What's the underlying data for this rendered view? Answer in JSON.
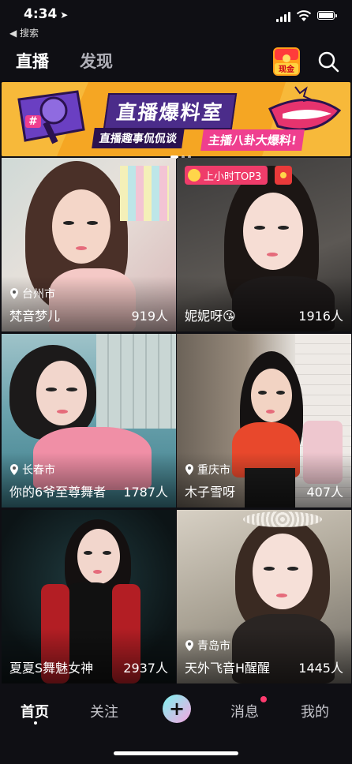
{
  "status_bar": {
    "time": "4:34",
    "back_label": "◀ 搜索"
  },
  "header": {
    "tabs": [
      {
        "label": "直播",
        "active": true
      },
      {
        "label": "发现",
        "active": false
      }
    ],
    "cash_label": "现金"
  },
  "banner": {
    "title": "直播爆料室",
    "subtitle_left": "直播趣事侃侃谈",
    "subtitle_right": "主播八卦大爆料!",
    "hashtag": "#"
  },
  "streams": [
    {
      "location": "台州市",
      "name": "梵音梦儿",
      "viewers": "919人"
    },
    {
      "location": "",
      "name": "妮妮呀😘",
      "viewers": "1916人",
      "badge": "上小时TOP3"
    },
    {
      "location": "长春市",
      "name": "你的6爷至尊舞者",
      "viewers": "1787人"
    },
    {
      "location": "重庆市",
      "name": "木子雪呀",
      "viewers": "407人"
    },
    {
      "location": "",
      "name": "夏夏S舞魅女神",
      "viewers": "2937人"
    },
    {
      "location": "青岛市",
      "name": "天外飞音H醒醒",
      "viewers": "1445人"
    }
  ],
  "bottom_nav": {
    "items": [
      {
        "label": "首页",
        "active": true
      },
      {
        "label": "关注",
        "active": false
      },
      {
        "label": "+",
        "active": false
      },
      {
        "label": "消息",
        "active": false
      },
      {
        "label": "我的",
        "active": false
      }
    ]
  },
  "colors": {
    "background": "#0f0f14",
    "banner_bg": "#f5a623",
    "badge": "#ef3c6a",
    "accent_pink": "#ff3b6f"
  }
}
